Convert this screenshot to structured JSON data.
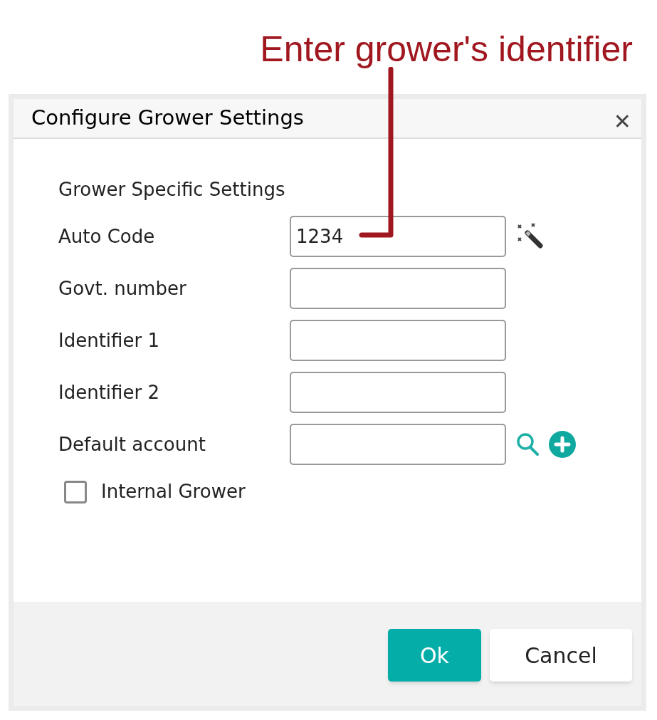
{
  "annotation": {
    "text": "Enter grower's identifier"
  },
  "dialog": {
    "title": "Configure Grower Settings",
    "close": "✕",
    "section_title": "Grower Specific Settings",
    "fields": [
      {
        "label": "Auto Code",
        "value": "1234",
        "actions": [
          {
            "kind": "wand"
          }
        ]
      },
      {
        "label": "Govt. number"
      },
      {
        "label": "Identifier 1"
      },
      {
        "label": "Identifier 2"
      },
      {
        "label": "Default account",
        "actions": [
          {
            "kind": "search"
          },
          {
            "kind": "add"
          }
        ]
      }
    ],
    "checkbox": {
      "label": "Internal Grower",
      "checked": false
    },
    "buttons": [
      {
        "label": "Ok",
        "kind": "primary"
      },
      {
        "label": "Cancel",
        "kind": "secondary"
      }
    ]
  }
}
